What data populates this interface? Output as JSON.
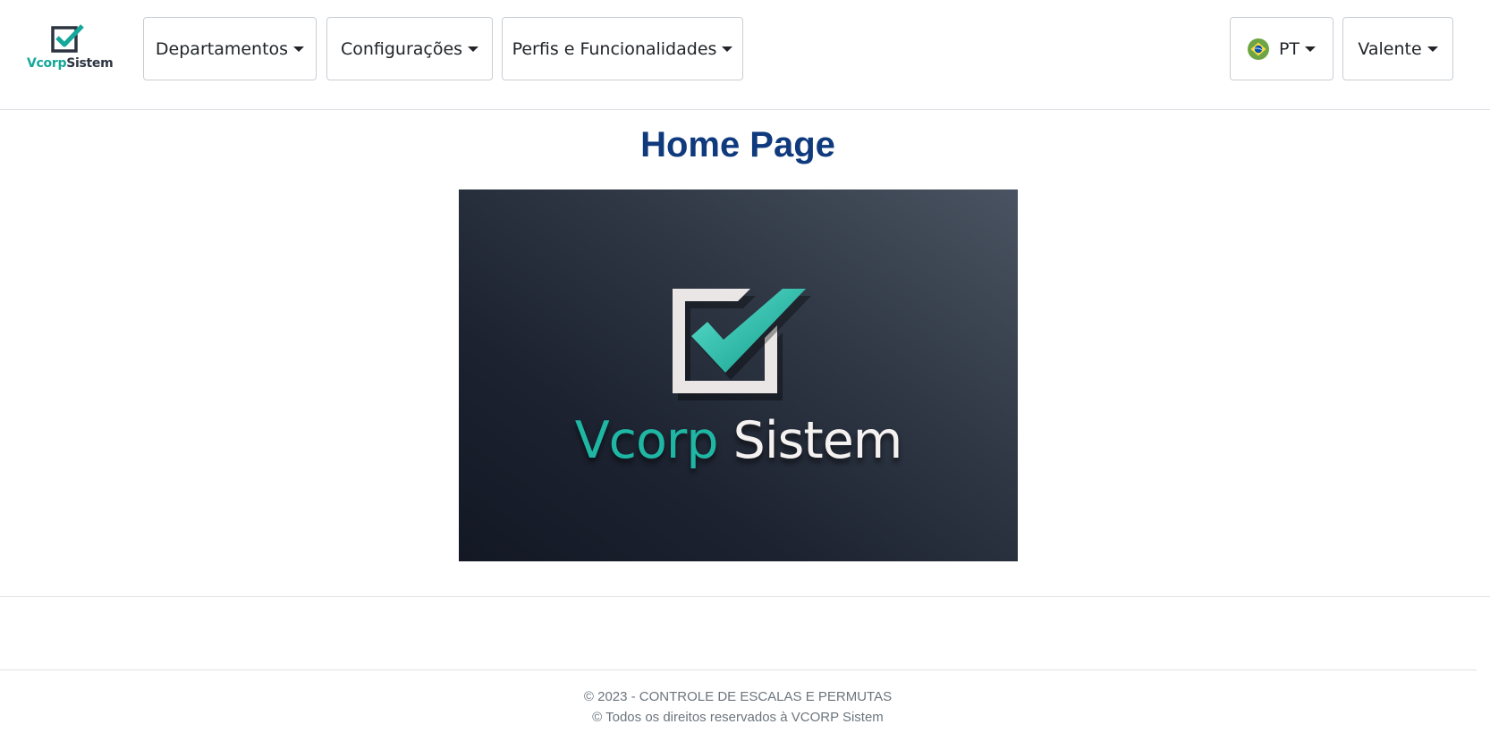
{
  "brand": {
    "name_part1": "Vcorp",
    "name_part2": "Sistem",
    "icon": "checkbox-check-icon",
    "accent": "#14a89a"
  },
  "nav": {
    "menus": [
      {
        "label": "Departamentos"
      },
      {
        "label": "Configurações"
      },
      {
        "label": "Perfis e Funcionalidades"
      }
    ],
    "language": {
      "label": "PT",
      "icon": "brazil-flag-icon"
    },
    "user": {
      "label": "Valente"
    }
  },
  "main": {
    "title": "Home Page",
    "hero": {
      "text_part1": "Vcorp",
      "text_part2": " Sistem",
      "icon": "checkbox-check-icon"
    }
  },
  "footer": {
    "line1": "© 2023 - CONTROLE DE ESCALAS E PERMUTAS",
    "line2": "© Todos os direitos reservados à VCORP Sistem"
  },
  "colors": {
    "title": "#0f3a7d",
    "teal": "#1fb7a4",
    "hero_bg": "#1c2230"
  }
}
